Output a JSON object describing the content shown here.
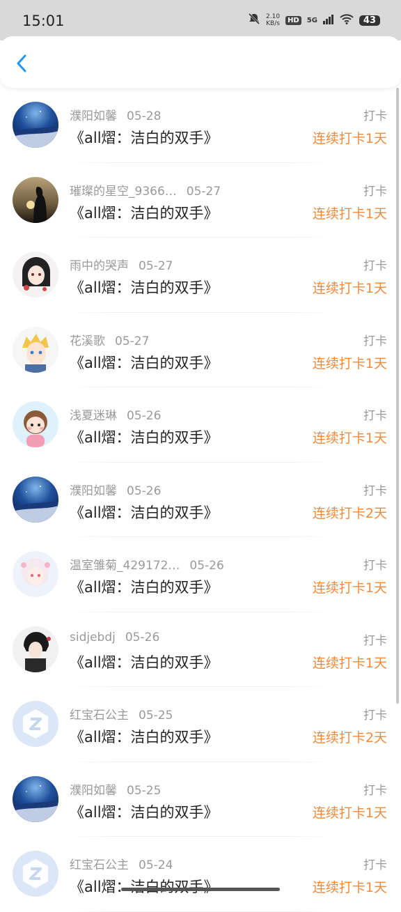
{
  "status_bar": {
    "time": "15:01",
    "speed_value": "2.10",
    "speed_unit": "KB/s",
    "hd": "HD",
    "network": "5G",
    "battery": "43"
  },
  "header": {
    "back_icon": "chevron-left-icon",
    "accent": "#2196f3"
  },
  "colors": {
    "streak": "#f08a3c",
    "muted": "#9a9a9a",
    "text": "#222222"
  },
  "list": [
    {
      "name": "濮阳如馨",
      "date": "05-28",
      "title": "《all熠：洁白的双手》",
      "tag": "打卡",
      "streak": "连续打卡1天",
      "avatar": "night-sky"
    },
    {
      "name": "璀璨的星空_9366…",
      "date": "05-27",
      "title": "《all熠：洁白的双手》",
      "tag": "打卡",
      "streak": "连续打卡1天",
      "avatar": "silhouette-sunset"
    },
    {
      "name": "雨中的哭声",
      "date": "05-27",
      "title": "《all熠：洁白的双手》",
      "tag": "打卡",
      "streak": "连续打卡1天",
      "avatar": "anime-girl-dark"
    },
    {
      "name": "花溪歌",
      "date": "05-27",
      "title": "《all熠：洁白的双手》",
      "tag": "打卡",
      "streak": "连续打卡1天",
      "avatar": "anime-blonde"
    },
    {
      "name": "浅夏迷琳",
      "date": "05-26",
      "title": "《all熠：洁白的双手》",
      "tag": "打卡",
      "streak": "连续打卡1天",
      "avatar": "cute-cartoon"
    },
    {
      "name": "濮阳如馨",
      "date": "05-26",
      "title": "《all熠：洁白的双手》",
      "tag": "打卡",
      "streak": "连续打卡2天",
      "avatar": "night-sky"
    },
    {
      "name": "温室雏菊_429172…",
      "date": "05-26",
      "title": "《all熠：洁白的双手》",
      "tag": "打卡",
      "streak": "连续打卡1天",
      "avatar": "anime-pastel"
    },
    {
      "name": "sidjebdj",
      "date": "05-26",
      "title": "《all熠：洁白的双手》",
      "tag": "打卡",
      "streak": "连续打卡1天",
      "avatar": "anime-dark-boy"
    },
    {
      "name": "红宝石公主",
      "date": "05-25",
      "title": "《all熠：洁白的双手》",
      "tag": "打卡",
      "streak": "连续打卡2天",
      "avatar": "default-placeholder"
    },
    {
      "name": "濮阳如馨",
      "date": "05-25",
      "title": "《all熠：洁白的双手》",
      "tag": "打卡",
      "streak": "连续打卡1天",
      "avatar": "night-sky"
    },
    {
      "name": "红宝石公主",
      "date": "05-24",
      "title": "《all熠：洁白的双手》",
      "tag": "打卡",
      "streak": "连续打卡1天",
      "avatar": "default-placeholder"
    }
  ]
}
